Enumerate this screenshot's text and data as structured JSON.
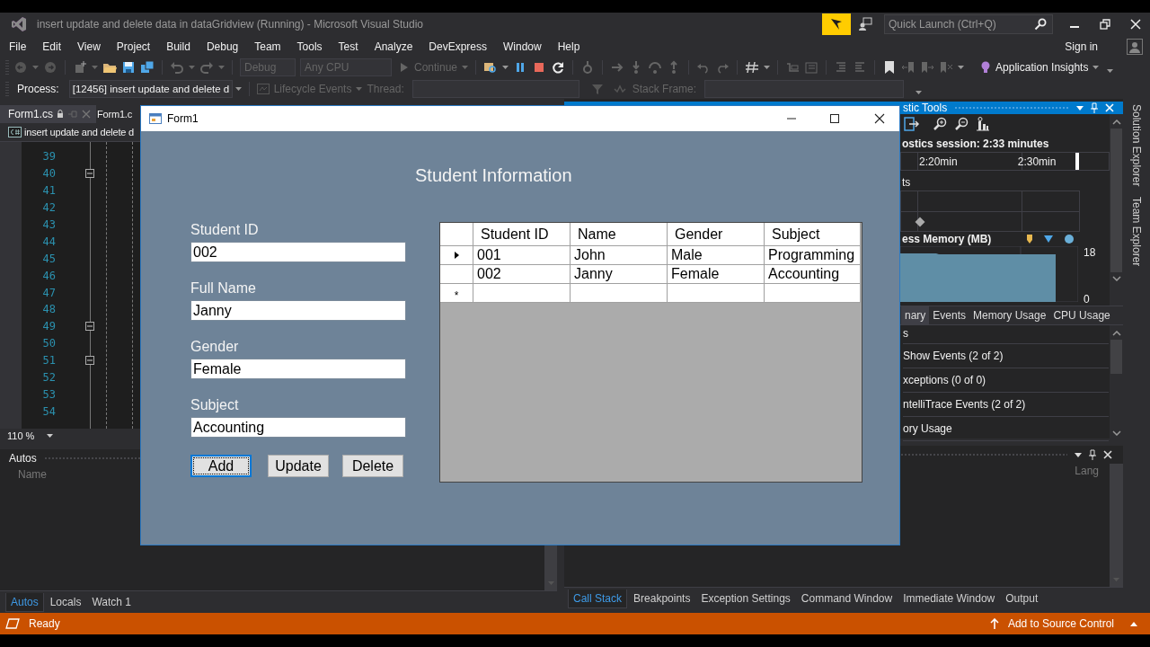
{
  "ide": {
    "title": "insert update and delete data in dataGridview (Running) - Microsoft Visual Studio",
    "quick_launch": {
      "placeholder": "Quick Launch (Ctrl+Q)"
    },
    "menu": [
      "File",
      "Edit",
      "View",
      "Project",
      "Build",
      "Debug",
      "Team",
      "Tools",
      "Test",
      "Analyze",
      "DevExpress",
      "Window",
      "Help"
    ],
    "sign_in": "Sign in",
    "toolbar": {
      "configuration": {
        "label": "Debug",
        "disabled": true
      },
      "platform": {
        "label": "Any CPU",
        "disabled": true
      },
      "continue": {
        "label": "Continue",
        "disabled": true
      },
      "insights": "Application Insights"
    },
    "debug_location": {
      "process_label": "Process:",
      "process": "[12456] insert update and delete d",
      "lifecycle": "Lifecycle Events",
      "thread_label": "Thread:",
      "stack_frame_label": "Stack Frame:"
    },
    "editor": {
      "tabs": [
        {
          "label": "Form1.cs",
          "selected": true
        },
        {
          "label": "Form1.c",
          "selected": false
        }
      ],
      "navigation": "insert update and delete d",
      "lines": [
        {
          "number": "39",
          "fold": false
        },
        {
          "number": "40",
          "fold": true
        },
        {
          "number": "41",
          "fold": false
        },
        {
          "number": "42",
          "fold": false
        },
        {
          "number": "43",
          "fold": false
        },
        {
          "number": "44",
          "fold": false
        },
        {
          "number": "45",
          "fold": false
        },
        {
          "number": "46",
          "fold": false
        },
        {
          "number": "47",
          "fold": false
        },
        {
          "number": "48",
          "fold": false
        },
        {
          "number": "49",
          "fold": true
        },
        {
          "number": "50",
          "fold": false
        },
        {
          "number": "51",
          "fold": true
        },
        {
          "number": "52",
          "fold": false
        },
        {
          "number": "53",
          "fold": false
        },
        {
          "number": "54",
          "fold": false
        }
      ],
      "zoom": "110 %"
    },
    "autos": {
      "title": "Autos",
      "column": "Name",
      "tabs": [
        {
          "label": "Autos",
          "selected": true
        },
        {
          "label": "Locals",
          "selected": false
        },
        {
          "label": "Watch 1",
          "selected": false
        }
      ]
    },
    "diagnostics": {
      "title": "stic Tools",
      "session": "ostics session: 2:33 minutes",
      "ruler": [
        "2:20min",
        "2:30min"
      ],
      "events_heading": "ts",
      "memory_heading": "ess Memory (MB)",
      "memory_max": "18",
      "memory_min": "0",
      "tabs": [
        {
          "label": "nary",
          "selected": true
        },
        {
          "label": "Events",
          "selected": false
        },
        {
          "label": "Memory Usage",
          "selected": false
        },
        {
          "label": "CPU Usage",
          "selected": false
        }
      ],
      "rows": [
        "s",
        "Show Events (2 of 2)",
        "xceptions (0 of 0)",
        "ntelliTrace Events (2 of 2)",
        "ory Usage"
      ]
    },
    "output_panel": {
      "column": "Lang",
      "tabs": [
        {
          "label": "Call Stack",
          "selected": true
        },
        {
          "label": "Breakpoints",
          "selected": false
        },
        {
          "label": "Exception Settings",
          "selected": false
        },
        {
          "label": "Command Window",
          "selected": false
        },
        {
          "label": "Immediate Window",
          "selected": false
        },
        {
          "label": "Output",
          "selected": false
        }
      ]
    },
    "side_tabs": [
      "Solution Explorer",
      "Team Explorer"
    ],
    "status_bar": {
      "text": "Ready",
      "action": "Add to Source Control"
    }
  },
  "form": {
    "title": "Form1",
    "heading": "Student Information",
    "fields": [
      {
        "label": "Student ID",
        "value": "002"
      },
      {
        "label": "Full Name",
        "value": "Janny"
      },
      {
        "label": "Gender",
        "value": "Female"
      },
      {
        "label": "Subject",
        "value": "Accounting"
      }
    ],
    "buttons": [
      {
        "label": "Add",
        "focused": true
      },
      {
        "label": "Update",
        "focused": false
      },
      {
        "label": "Delete",
        "focused": false
      }
    ],
    "grid": {
      "columns": [
        "Student ID",
        "Name",
        "Gender",
        "Subject"
      ],
      "rows": [
        {
          "cells": [
            "001",
            "John",
            "Male",
            "Programming"
          ],
          "current": true
        },
        {
          "cells": [
            "002",
            "Janny",
            "Female",
            "Accounting"
          ],
          "current": false
        }
      ],
      "new_row_marker": "*"
    }
  }
}
